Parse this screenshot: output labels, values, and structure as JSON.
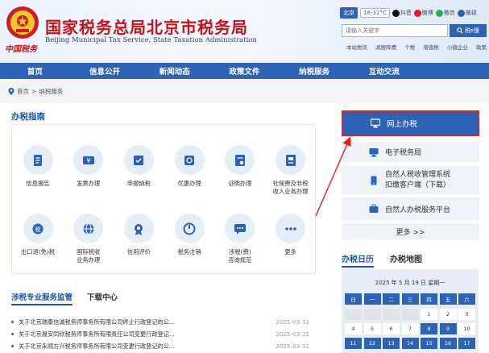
{
  "header": {
    "title_cn": "国家税务总局北京市税务局",
    "title_en": "Beijing Municipal Tax Service, State Taxation Administration",
    "slogan": "中国税务",
    "top": {
      "city": "北京",
      "temp": "18-31°C",
      "social": [
        "抖音",
        "微博",
        "微信",
        "微视"
      ]
    },
    "search_placeholder": "请输入关键字",
    "search_btn": "税e搜",
    "quick_links": [
      "本站税讯",
      "减税降费",
      "个税",
      "增值税",
      "小微企业",
      "政策"
    ]
  },
  "nav": [
    "首页",
    "信息公开",
    "新闻动态",
    "政策文件",
    "纳税服务",
    "互动交流"
  ],
  "breadcrumb": {
    "home": "首页",
    "sep": ">",
    "current": "纳税服务"
  },
  "guide": {
    "tab": "办税指南",
    "items": [
      {
        "label": "信息报告"
      },
      {
        "label": "发票办理"
      },
      {
        "label": "申报纳税"
      },
      {
        "label": "优惠办理"
      },
      {
        "label": "证明办理"
      },
      {
        "label": "社保费及非税\n收入业务办理"
      },
      {
        "label": "出口退(免)税"
      },
      {
        "label": "国际税收\n业务办理"
      },
      {
        "label": "信用评价"
      },
      {
        "label": "税务注销"
      },
      {
        "label": "涉税(费)\n咨询规范"
      },
      {
        "label": "更多"
      }
    ]
  },
  "sections": {
    "supervise": "涉税专业服务监管",
    "download": "下载中心"
  },
  "news": [
    {
      "title": "关于北京瑞泰信诚税务师事务所有限公司终止行政登记的公...",
      "date": "2025-03-31"
    },
    {
      "title": "关于北京晟安同欣税务师事务所有限责任公司变更行政登记...",
      "date": "2025-03-31"
    },
    {
      "title": "关于北京永顺方兴税务师事务所有限公司变更行政登记的公...",
      "date": "2025-03-31"
    }
  ],
  "side": {
    "online": "网上办税",
    "etax": "电子税务局",
    "natural_line1": "自然人税收管理系统",
    "natural_line2": "扣缴客户端（下载）",
    "natapp": "自然人办税服务平台",
    "more": "更多 >>"
  },
  "side_tabs": {
    "calendar": "办税日历",
    "map": "办税地图"
  },
  "calendar": {
    "header": "2025 年 5 月 19 日 星期一",
    "weekdays": [
      "日",
      "一",
      "二",
      "三",
      "四",
      "五",
      "六"
    ],
    "rows": [
      [
        "",
        "",
        "",
        "",
        "1",
        "2",
        "3"
      ],
      [
        "4",
        "5",
        "6",
        "7",
        "8",
        "9",
        "10"
      ],
      [
        "11",
        "12",
        "13",
        "14",
        "15",
        "16",
        "17"
      ]
    ],
    "highlighted_days": [
      "8",
      "9",
      "11",
      "12",
      "13",
      "14",
      "15",
      "16",
      "17"
    ]
  },
  "colors": {
    "brand_blue": "#2d62b5",
    "title_red": "#c3141c",
    "highlight_border": "#d2262b",
    "annotation_red": "#e02020"
  }
}
